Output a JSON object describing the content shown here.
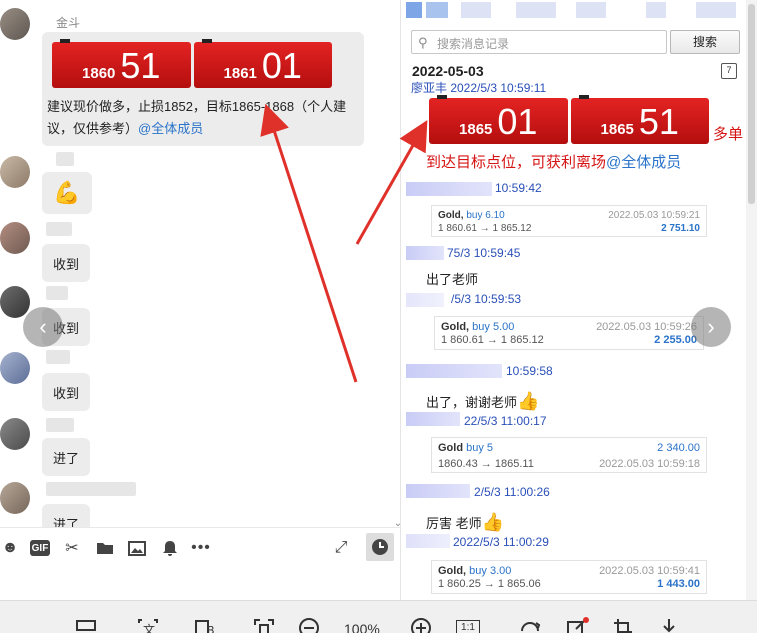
{
  "left_chat": {
    "sender_name": "金斗",
    "price_board": [
      {
        "small": "1860",
        "large": "51"
      },
      {
        "small": "1861",
        "large": "01"
      }
    ],
    "advice_text": "建议现价做多，止损1852，目标1865-1868（个人建议，仅供参考）",
    "mention": "@全体成员",
    "emoji": "💪",
    "replies": [
      "收到",
      "收到",
      "收到",
      "进了",
      "进了"
    ]
  },
  "left_toolbar": {
    "gif_label": "GIF",
    "icons": [
      "emoji-icon",
      "gif-icon",
      "scissors-icon",
      "folder-icon",
      "image-icon",
      "bell-icon",
      "more-icon",
      "expand-icon",
      "history-clock-icon"
    ]
  },
  "right_panel": {
    "search_placeholder": "搜索消息记录",
    "search_button": "搜索",
    "date": "2022-05-03",
    "calendar_label": "7",
    "cut_line": "廖亚丰 2022/5/3 10:59:11",
    "board2": [
      {
        "small": "1865",
        "large": "01"
      },
      {
        "small": "1865",
        "large": "51"
      }
    ],
    "duodan": "多单",
    "target_text": "到达目标点位，可获利离场",
    "target_mention": "@全体成员",
    "messages": [
      {
        "time": "10:59:42",
        "card": {
          "gold": "Gold,",
          "buy": "buy 6.10",
          "prices": "1 860.61 → 1 865.12",
          "ts": "2022.05.03 10:59:21",
          "amount": "2 751.10"
        }
      },
      {
        "time": "75/3 10:59:45",
        "text": "出了老师"
      },
      {
        "time": "/5/3 10:59:53",
        "card": {
          "gold": "Gold,",
          "buy": "buy 5.00",
          "prices": "1 860.61 → 1 865.12",
          "ts": "2022.05.03 10:59:26",
          "amount": "2 255.00"
        }
      },
      {
        "time": "10:59:58",
        "text": "出了，谢谢老师"
      },
      {
        "time": "22/5/3 11:00:17",
        "card": {
          "gold": "Gold",
          "buy": "buy 5",
          "prices": "1860.43 → 1865.11",
          "ts": "2022.05.03 10:59:18",
          "amount": "2 340.00"
        }
      },
      {
        "time": "2/5/3 11:00:26",
        "text": "厉害 老师"
      },
      {
        "time": "2022/5/3 11:00:29",
        "card": {
          "gold": "Gold,",
          "buy": "buy 3.00",
          "prices": "1 860.25 → 1 865.06",
          "ts": "2022.05.03 10:59:41",
          "amount": "1 443.00"
        }
      }
    ],
    "thumb": "👍"
  },
  "viewer_toolbar": {
    "zoom": "100%",
    "one_to_one": "1:1"
  },
  "colors": {
    "board_red": "#d61a1a",
    "mention_blue": "#2a73c9",
    "arrow_red": "#e0302a"
  }
}
